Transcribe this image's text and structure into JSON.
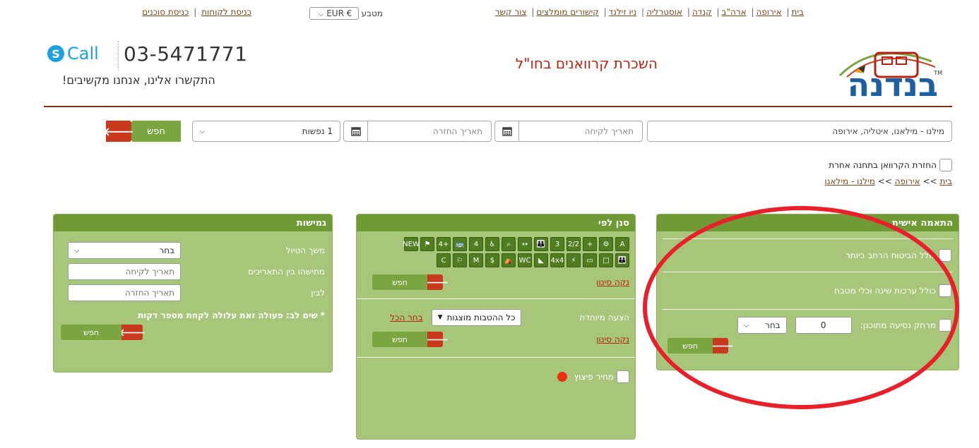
{
  "topnav": {
    "left_links": [
      "כניסת לקוחות",
      "כניסת סוכנים"
    ],
    "currency_label": "מטבע",
    "currency_value": "EUR €",
    "right_links": [
      "בית",
      "אירופה",
      "ארה\"ב",
      "קנדה",
      "אוסטרליה",
      "ניו זילנד",
      "קישורים מומלצים",
      "צור קשר"
    ]
  },
  "header": {
    "logo_text": "בנדנה",
    "logo_tm": "TM",
    "site_title": "השכרת קרוואנים בחו\"ל",
    "phone": "03-5471771",
    "call_label": "Call",
    "tagline": "התקשרו אלינו, אנחנו מקשיבים!"
  },
  "search": {
    "destination": "מילנו - מילאנו, איטליה, אירופה",
    "pickup_placeholder": "תאריך לקיחה",
    "return_placeholder": "תאריך החזרה",
    "passengers": "1 נפשות",
    "search_label": "חפש",
    "return_other_station": "החזרת הקרוואן בתחנה אחרת"
  },
  "breadcrumb": {
    "items": [
      "בית",
      "אירופה",
      "מילנו - מילאנו"
    ],
    "sep": ">>"
  },
  "personal": {
    "title": "התאמה אישית",
    "opt_insurance": "כולל הביטוח הרחב ביותר",
    "opt_bedding": "כולל ערכות שינה וכלי מטבח",
    "opt_distance": "מרחק נסיעה מתוכנן:",
    "distance_value": "0",
    "distance_unit": "בחר",
    "search_label": "חפש"
  },
  "filter": {
    "title": "סנן לפי",
    "icons": [
      "A",
      "⚙",
      "+",
      "2/2",
      "3",
      "👪",
      "↔",
      "⌕",
      "♿",
      "4",
      "🚌",
      "+4",
      "⚑",
      "NEW",
      "👪",
      "□",
      "▭",
      "⚡",
      "4x4",
      "◣",
      "WC",
      "⛺",
      "$",
      "M",
      "⚐",
      "C"
    ],
    "clear_label": "נקה סינון",
    "search_label": "חפש",
    "special_label": "הצעה מיוחדת",
    "special_value": "כל ההטבות מוצגות",
    "select_all": "בחר הכל",
    "bargain_label": "מחיר פיצוץ"
  },
  "flex": {
    "title": "גמישות",
    "duration_label": "משך הטיול",
    "duration_value": "בחר",
    "between_label": "מתישהו בין התאריכים",
    "from_placeholder": "תאריך לקיחה",
    "to_label": "לבין",
    "to_placeholder": "תאריך החזרה",
    "note": "* שים לב: פעולה זאת עלולה לקחת מספר דקות",
    "search_label": "חפש"
  }
}
